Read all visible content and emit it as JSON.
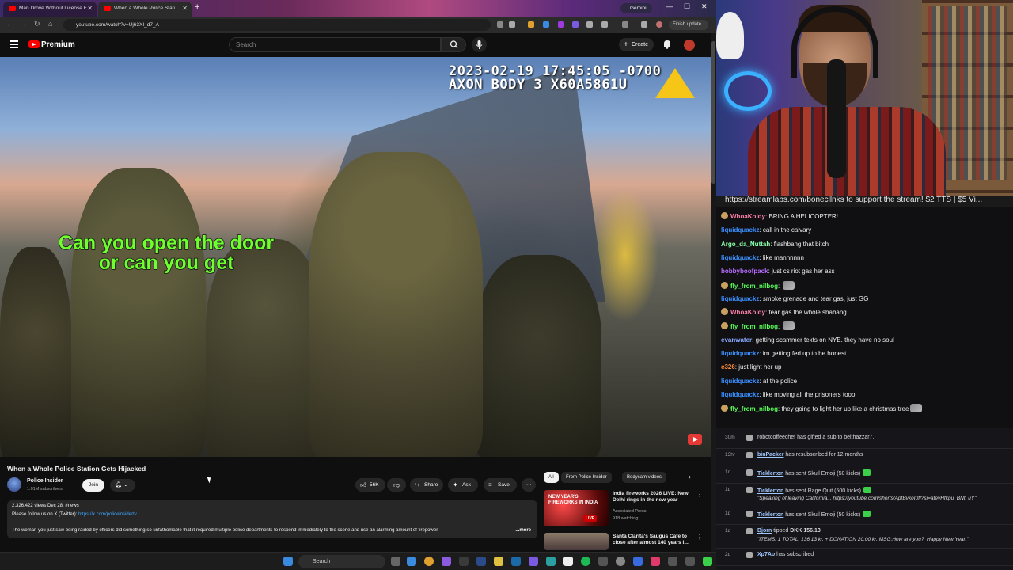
{
  "browser": {
    "tabs": [
      {
        "title": "Man Drove Without License F"
      },
      {
        "title": "When a Whole Police Stati"
      }
    ],
    "gemini_label": "Gemini",
    "url": "youtube.com/watch?v=Uj63XI_d7_A",
    "finish_update_label": "Finish update"
  },
  "youtube": {
    "brand": "Premium",
    "search_placeholder": "Search",
    "create_label": "Create"
  },
  "video": {
    "timestamp_line1": "2023-02-19 17:45:05 -0700",
    "timestamp_line2": "AXON BODY 3 X60A5861U",
    "caption": "Can you open the door or can you get",
    "title": "When a Whole Police Station Gets Hijacked",
    "channel": "Police Insider",
    "subscribers": "1.01M subscribers",
    "join_label": "Join",
    "likes": "56K",
    "share_label": "Share",
    "ask_label": "Ask",
    "save_label": "Save",
    "views_line": "2,326,422 views  Dec 28,  #news",
    "follow_text": "Please follow us on X (Twitter): ",
    "follow_link": "https://x.com/policeinsidertv",
    "description": "The woman you just saw being raided by officers did something so unfathomable that it required multiple police departments to respond immediately to the scene and use an alarming amount of firepower.",
    "more_label": "...more"
  },
  "sidebar": {
    "chips": [
      "All",
      "From Police Insider",
      "Bodycam videos"
    ],
    "recs": [
      {
        "thumb_text": "NEW YEAR'S FIREWORKS IN INDIA",
        "live_badge": "LIVE",
        "title": "India fireworks 2026 LIVE: New Delhi rings in the new year",
        "channel": "Associated Press",
        "meta": "918 watching"
      },
      {
        "title": "Santa Clarita's Saugus Cafe to close after almost 140 years i..."
      }
    ]
  },
  "chat": {
    "ticker": "https://streamlabs.com/bonecllnks to support the stream! $2 TTS | $5 Vi...",
    "messages": [
      {
        "user": "WhoaKoldy",
        "text": "BRING A HELICOPTER!",
        "color": "#ff7fa7",
        "badge": true
      },
      {
        "user": "liquidquackz",
        "text": "call in the calvary",
        "color": "#3a8fff"
      },
      {
        "user": "Argo_da_Nuttah",
        "text": "flashbang that bitch",
        "color": "#8affa8"
      },
      {
        "user": "liquidquackz",
        "text": "like mannnnnn",
        "color": "#3a8fff"
      },
      {
        "user": "bobbyboofpack",
        "text": "just cs riot gas her ass",
        "color": "#b86cff"
      },
      {
        "user": "fly_from_nilbog",
        "text": "",
        "color": "#5aff5a",
        "badge": true,
        "emote": true
      },
      {
        "user": "liquidquackz",
        "text": "smoke grenade and tear gas, just GG",
        "color": "#3a8fff"
      },
      {
        "user": "WhoaKoldy",
        "text": "tear gas the whole shabang",
        "color": "#ff7fa7",
        "badge": true
      },
      {
        "user": "fly_from_nilbog",
        "text": "",
        "color": "#5aff5a",
        "badge": true,
        "emote": true
      },
      {
        "user": "evanwater",
        "text": "getting scammer texts on NYE. they have no soul",
        "color": "#8aa8ff"
      },
      {
        "user": "liquidquackz",
        "text": "im getting fed up to be honest",
        "color": "#3a8fff"
      },
      {
        "user": "c326",
        "text": "just light her up",
        "color": "#ff8a3a"
      },
      {
        "user": "liquidquackz",
        "text": "at the police",
        "color": "#3a8fff"
      },
      {
        "user": "liquidquackz",
        "text": "like moving all the prisoners tooo",
        "color": "#3a8fff"
      },
      {
        "user": "fly_from_nilbog",
        "text": "they going to light her up like a christmas tree",
        "color": "#5aff5a",
        "badge": true,
        "emote": true
      }
    ],
    "events": [
      {
        "time": "30m",
        "name": "robotcoffeechef",
        "text": " has gifted a sub to ",
        "target": "belthazzar7.",
        "plain": true
      },
      {
        "time": "13hr",
        "name": "binPacker",
        "text": " has resubscribed for 12 months"
      },
      {
        "time": "1d",
        "name": "Ticklerton",
        "text": " has sent Skull Emoji (50 kicks)",
        "gem": true
      },
      {
        "time": "1d",
        "name": "Ticklerton",
        "text": " has sent Rage Quit (500 kicks)",
        "gem": true,
        "sub": "\"Speaking of leaving California... https://youtube.com/shorts/ApfBvkoI0fI?si=atevHfkpu_BNt_uY\""
      },
      {
        "time": "1d",
        "name": "Ticklerton",
        "text": " has sent Skull Emoji (50 kicks)",
        "gem": true
      },
      {
        "time": "1d",
        "name": "Bjorn",
        "text": " tipped ",
        "amount": "DKK 156.13",
        "sub": "\"ITEMS: 1 TOTAL: 136.13 kr. + DONATION 20.00 kr. MSG:How are you?_Happy New Year.\""
      },
      {
        "time": "2d",
        "name": "Xp7Ao",
        "text": " has subscribed"
      }
    ]
  },
  "taskbar": {
    "search_label": "Search"
  }
}
